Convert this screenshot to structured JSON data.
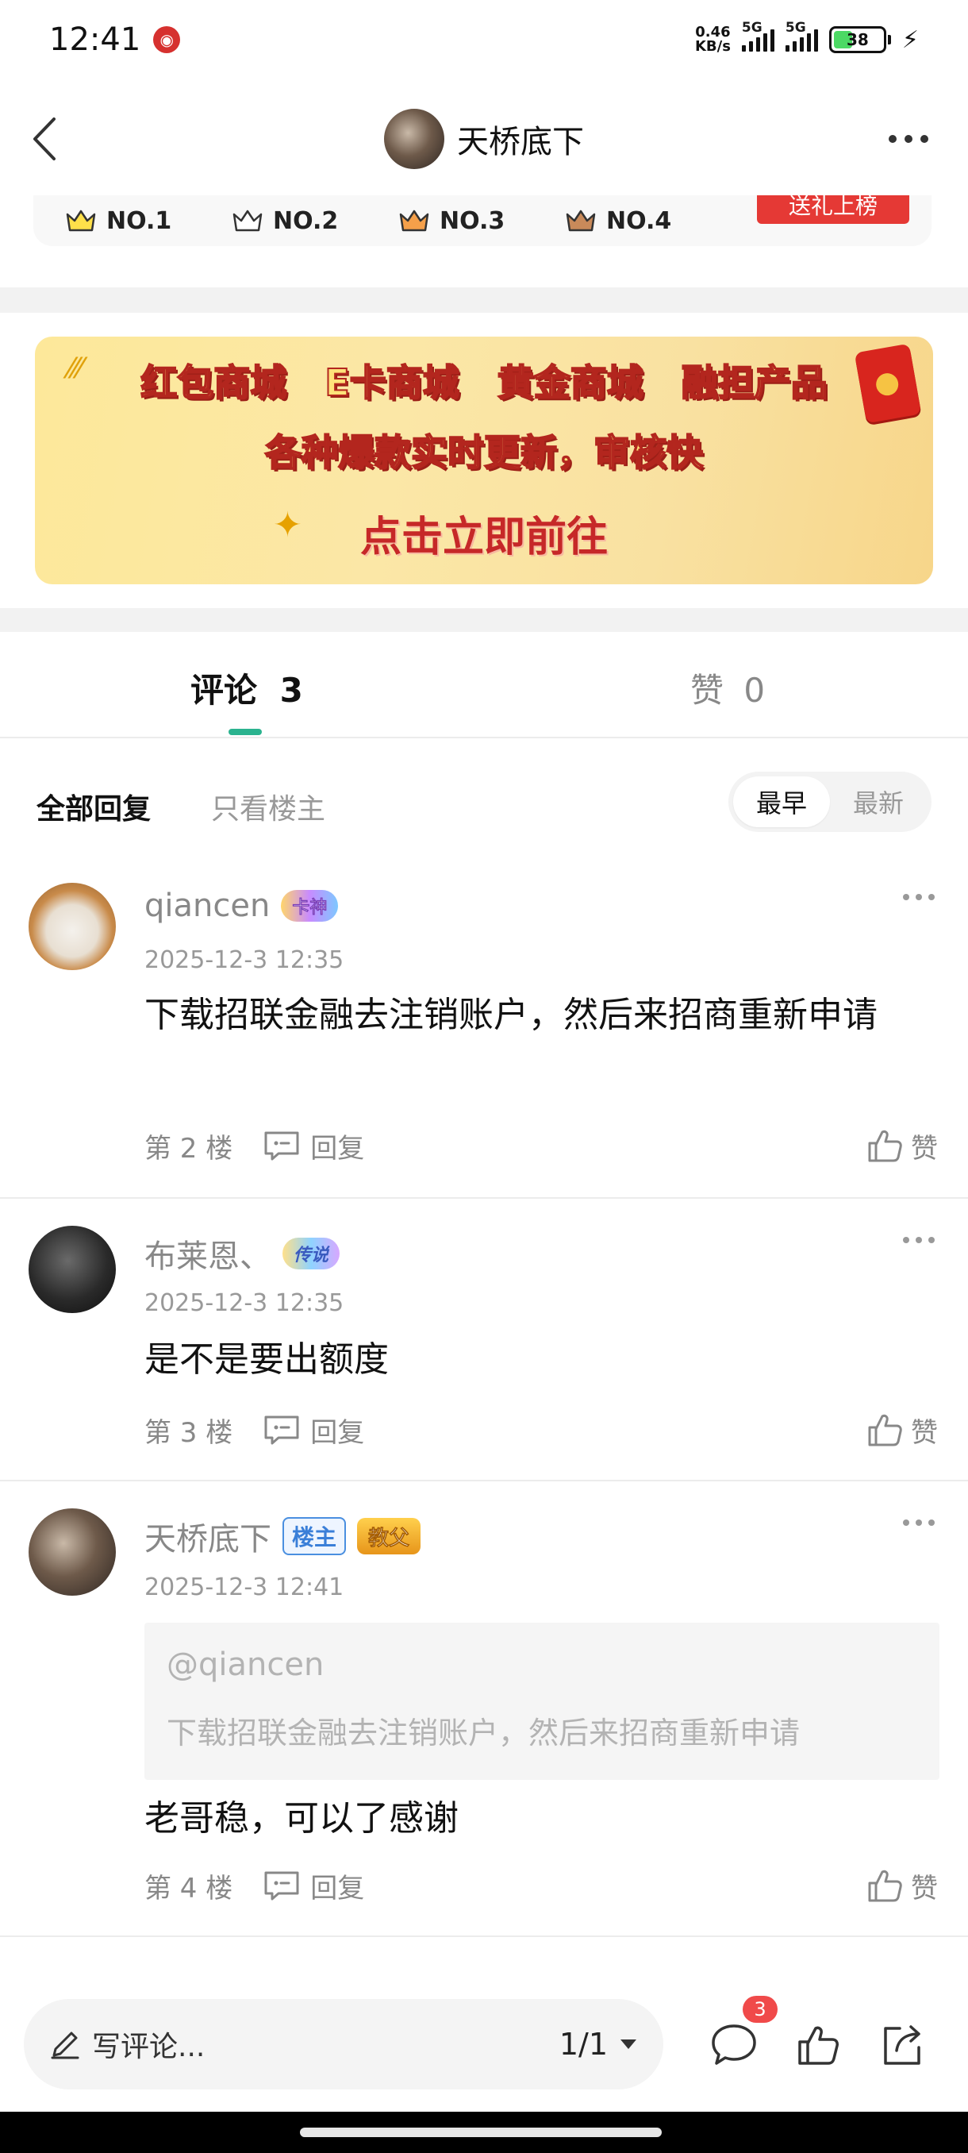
{
  "status_bar": {
    "time": "12:41",
    "net_speed_value": "0.46",
    "net_speed_unit": "KB/s",
    "signal1_label": "5G",
    "signal2_label": "5G",
    "battery_level": "38"
  },
  "header": {
    "title": "天桥底下"
  },
  "rank_strip": {
    "ranks": [
      "NO.1",
      "NO.2",
      "NO.3",
      "NO.4"
    ],
    "gift_button": "送礼上榜"
  },
  "banner": {
    "items": [
      "红包商城",
      "E卡商城",
      "黄金商城",
      "融担产品"
    ],
    "subtitle": "各种爆款实时更新，审核快",
    "cta": "点击立即前往"
  },
  "tabs": {
    "comments_label": "评论",
    "comments_count": "3",
    "likes_label": "赞",
    "likes_count": "0"
  },
  "filters": {
    "all": "全部回复",
    "op_only": "只看楼主",
    "sort_earliest": "最早",
    "sort_latest": "最新"
  },
  "comments": [
    {
      "user": "qiancen",
      "badge": "卡神",
      "time": "2025-12-3 12:35",
      "body": "下载招联金融去注销账户，然后来招商重新申请",
      "floor": "第 2 楼",
      "reply": "回复",
      "like": "赞"
    },
    {
      "user": "布莱恩、",
      "badge": "传说",
      "time": "2025-12-3 12:35",
      "body": "是不是要出额度",
      "floor": "第 3 楼",
      "reply": "回复",
      "like": "赞"
    },
    {
      "user": "天桥底下",
      "owner_badge": "楼主",
      "badge": "教父",
      "time": "2025-12-3 12:41",
      "quote_user": "@qiancen",
      "quote_text": "下载招联金融去注销账户，然后来招商重新申请",
      "body": "老哥稳，可以了感谢",
      "floor": "第 4 楼",
      "reply": "回复",
      "like": "赞"
    }
  ],
  "bottom_bar": {
    "write_placeholder": "写评论...",
    "page_indicator": "1/1",
    "comment_count_badge": "3"
  },
  "colors": {
    "accent": "#2bb38f",
    "badge_red": "#f04a4a",
    "gift_red": "#e53935"
  }
}
